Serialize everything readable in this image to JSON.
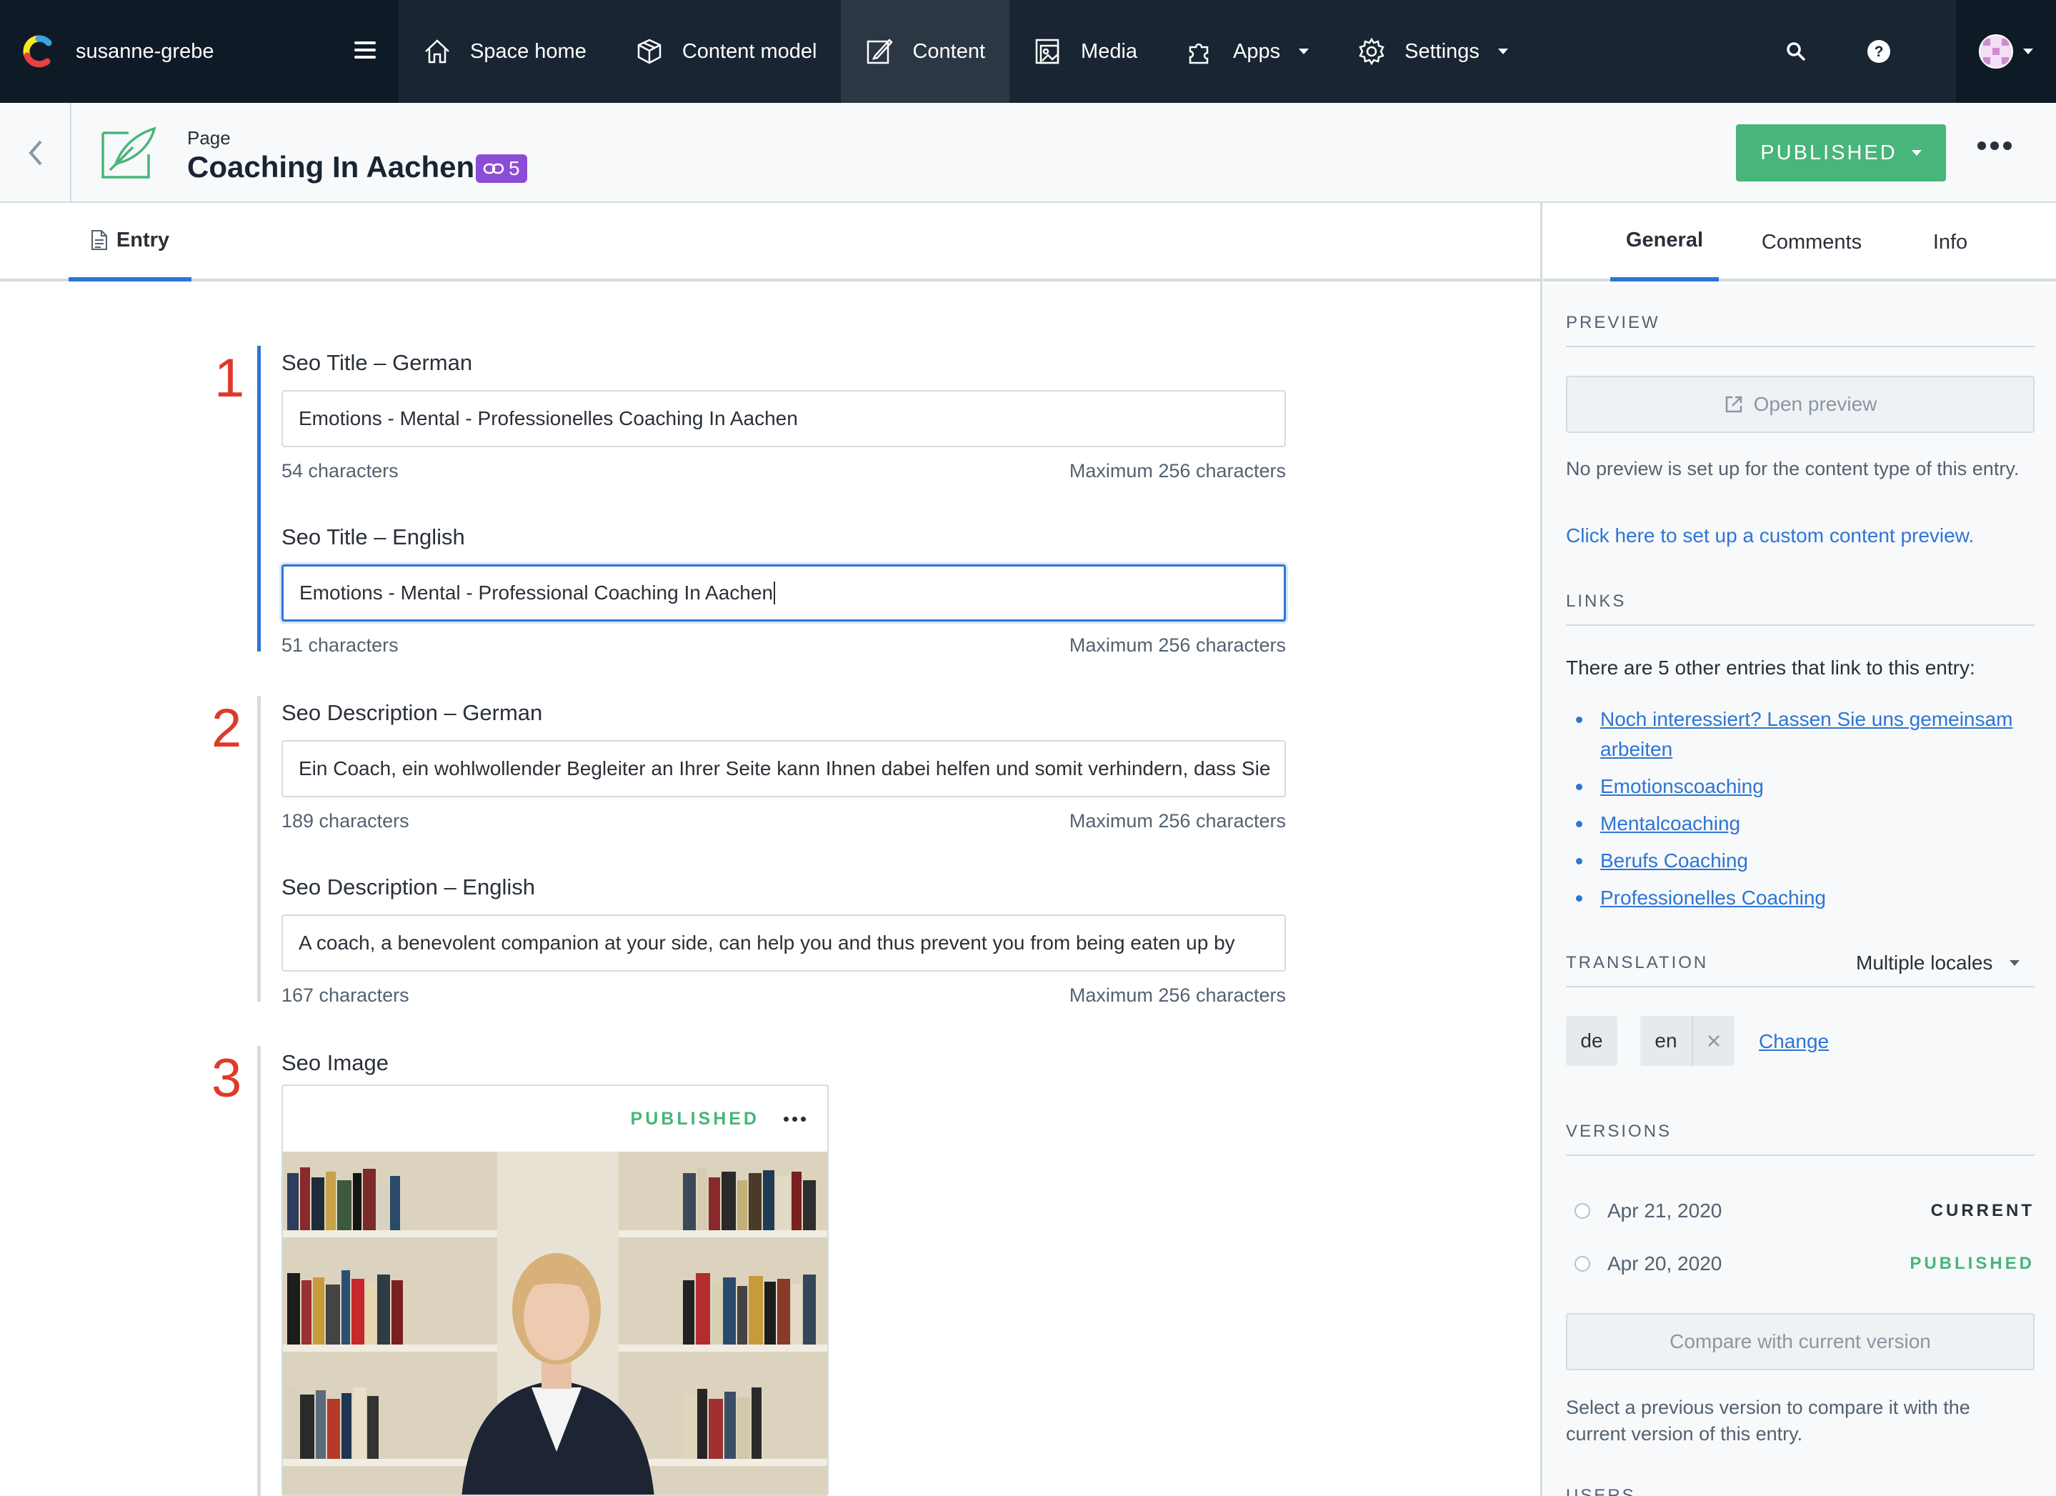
{
  "nav": {
    "space_name": "susanne-grebe",
    "items": [
      {
        "label": "Space home"
      },
      {
        "label": "Content model"
      },
      {
        "label": "Content"
      },
      {
        "label": "Media"
      },
      {
        "label": "Apps"
      },
      {
        "label": "Settings"
      }
    ]
  },
  "header": {
    "content_type": "Page",
    "title": "Coaching In Aachen",
    "references_count": "5",
    "status_button": "PUBLISHED"
  },
  "tabs": {
    "entry": "Entry"
  },
  "fields": {
    "seo_title_de": {
      "label": "Seo Title – German",
      "value": "Emotions - Mental - Professionelles Coaching In Aachen",
      "count": "54 characters",
      "max": "Maximum 256 characters"
    },
    "seo_title_en": {
      "label": "Seo Title – English",
      "value": "Emotions - Mental - Professional Coaching In Aachen",
      "count": "51 characters",
      "max": "Maximum 256 characters"
    },
    "seo_desc_de": {
      "label": "Seo Description – German",
      "value": "Ein Coach, ein wohlwollender Begleiter an Ihrer Seite kann Ihnen dabei helfen und somit verhindern, dass Sie",
      "count": "189 characters",
      "max": "Maximum 256 characters"
    },
    "seo_desc_en": {
      "label": "Seo Description – English",
      "value": "A coach, a benevolent companion at your side, can help you and thus prevent you from being eaten up by",
      "count": "167 characters",
      "max": "Maximum 256 characters"
    },
    "seo_image": {
      "label": "Seo Image",
      "status": "PUBLISHED"
    }
  },
  "annotations": {
    "n1": "1",
    "n2": "2",
    "n3": "3"
  },
  "sidebar": {
    "tabs": [
      "General",
      "Comments",
      "Info"
    ],
    "preview": {
      "title": "PREVIEW",
      "button": "Open preview",
      "note": "No preview is set up for the content type of this entry.",
      "link": "Click here to set up a custom content preview."
    },
    "links": {
      "title": "LINKS",
      "intro": "There are 5 other entries that link to this entry:",
      "items": [
        "Noch interessiert? Lassen Sie uns gemeinsam arbeiten",
        "Emotionscoaching",
        "Mentalcoaching",
        "Berufs Coaching",
        "Professionelles Coaching"
      ]
    },
    "translation": {
      "title": "TRANSLATION",
      "select": "Multiple locales",
      "locales": [
        "de",
        "en"
      ],
      "change": "Change"
    },
    "versions": {
      "title": "VERSIONS",
      "items": [
        {
          "date": "Apr 21, 2020",
          "status": "CURRENT"
        },
        {
          "date": "Apr 20, 2020",
          "status": "PUBLISHED"
        }
      ],
      "compare_button": "Compare with current version",
      "note": "Select a previous version to compare it with the current version of this entry."
    },
    "users_title": "USERS"
  },
  "colors": {
    "nav_bg": "#192532",
    "accent_blue": "#2e75d4",
    "published_green": "#48b57a",
    "annotation_red": "#e0392a",
    "reference_purple": "#8c4dd6"
  }
}
